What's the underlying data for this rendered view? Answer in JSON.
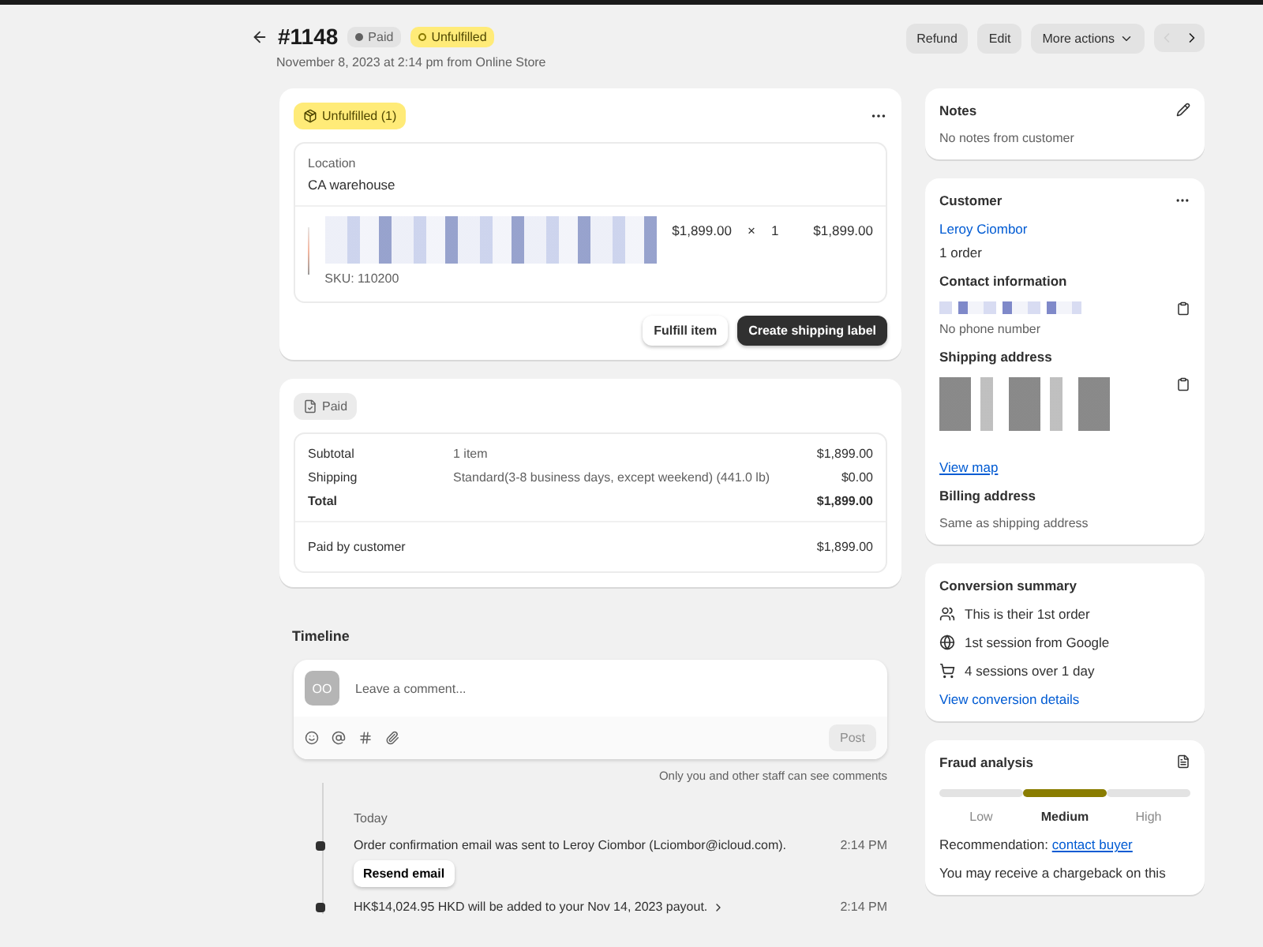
{
  "header": {
    "order": "#1148",
    "badges": [
      {
        "label": "Paid",
        "kind": "paid"
      },
      {
        "label": "Unfulfilled",
        "kind": "unfulfilled"
      }
    ],
    "subtitle": "November 8, 2023 at 2:14 pm from Online Store",
    "actions": [
      {
        "label": "Refund",
        "kind": "button"
      },
      {
        "label": "Edit",
        "kind": "button"
      },
      {
        "label": "More actions",
        "kind": "menu"
      }
    ],
    "pager": [
      {
        "kind": "prev",
        "disabled": true
      },
      {
        "kind": "next",
        "disabled": false
      }
    ]
  },
  "fulfillment": {
    "badge": "Unfulfilled (1)",
    "location_label": "Location",
    "location": "CA warehouse",
    "item": {
      "price": "$1,899.00",
      "times": "×",
      "quantity": "1",
      "total": "$1,899.00",
      "sku": "SKU: 110200"
    },
    "buttons": [
      {
        "label": "Fulfill item",
        "kind": "secondary"
      },
      {
        "label": "Create shipping label",
        "kind": "primary"
      }
    ]
  },
  "payment": {
    "badge": "Paid",
    "rows": [
      {
        "label": "Subtotal",
        "detail": "1 item",
        "amount": "$1,899.00",
        "kind": "normal"
      },
      {
        "label": "Shipping",
        "detail": "Standard(3-8 business days, except weekend) (441.0 lb)",
        "amount": "$0.00",
        "kind": "normal"
      },
      {
        "label": "Total",
        "amount": "$1,899.00",
        "kind": "total"
      }
    ],
    "paid_label": "Paid by customer",
    "paid_amount": "$1,899.00"
  },
  "timeline": {
    "title": "Timeline",
    "avatar": "OO",
    "placeholder": "Leave a comment...",
    "post": {
      "label": "Post",
      "disabled": true
    },
    "note": "Only you and other staff can see comments",
    "day": "Today",
    "events": [
      {
        "text": "Order confirmation email was sent to Leroy Ciombor (Lciombor@icloud.com).",
        "time": "2:14 PM",
        "action": "Resend email",
        "kind": "plain"
      },
      {
        "text": "HK$14,024.95 HKD will be added to your Nov 14, 2023 payout.",
        "time": "2:14 PM",
        "kind": "link"
      }
    ]
  },
  "notes": {
    "title": "Notes",
    "text": "No notes from customer"
  },
  "customer": {
    "title": "Customer",
    "name": "Leroy Ciombor",
    "orders": "1 order",
    "contact_title": "Contact information",
    "phone": "No phone number",
    "shipping_title": "Shipping address",
    "view_map": "View map",
    "billing_title": "Billing address",
    "billing": "Same as shipping address"
  },
  "conversion": {
    "title": "Conversion summary",
    "items": [
      {
        "text": "This is their 1st order",
        "kind": "order"
      },
      {
        "text": "1st session from Google",
        "kind": "session"
      },
      {
        "text": "4 sessions over 1 day",
        "kind": "sessions"
      }
    ],
    "link": "View conversion details"
  },
  "fraud": {
    "title": "Fraud analysis",
    "levels": [
      {
        "label": "Low",
        "selected": false
      },
      {
        "label": "Medium",
        "selected": true
      },
      {
        "label": "High",
        "selected": false
      }
    ],
    "recommendation": "Recommendation:",
    "recommendation_link": "contact buyer",
    "text": "You may receive a chargeback on this"
  }
}
